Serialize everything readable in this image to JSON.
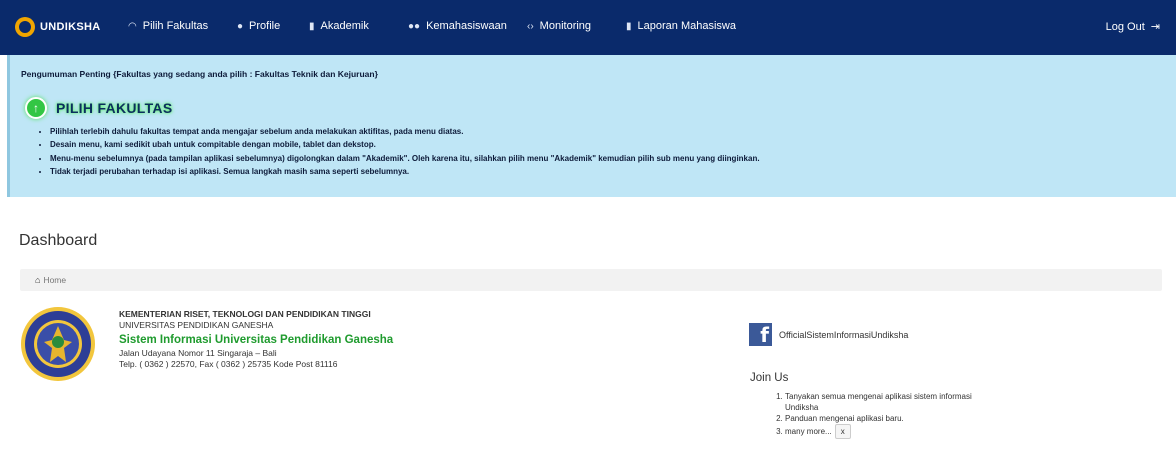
{
  "navbar": {
    "brand": "UNDIKSHA",
    "items": [
      {
        "icon": "dashboard-icon",
        "glyph": "⌒",
        "label": "Pilih Fakultas"
      },
      {
        "icon": "user-icon",
        "glyph": "▲",
        "label": "Profile"
      },
      {
        "icon": "book-icon",
        "glyph": "▮",
        "label": "Akademik"
      },
      {
        "icon": "users-icon",
        "glyph": "▲",
        "label": "Kemahasiswaan"
      },
      {
        "icon": "code-icon",
        "glyph": "‹›",
        "label": "Monitoring"
      },
      {
        "icon": "book-icon",
        "glyph": "▮",
        "label": "Laporan Mahasiswa"
      }
    ],
    "logout_label": "Log Out",
    "colors": {
      "background": "#0a2a6b",
      "brand_accent": "#f0a500"
    }
  },
  "announcement": {
    "title": "Pengumuman Penting {Fakultas yang sedang anda pilih : Fakultas Teknik dan Kejuruan}",
    "heading": "PILIH FAKULTAS",
    "items": [
      "Pilihlah terlebih dahulu fakultas tempat anda mengajar sebelum anda melakukan aktifitas, pada menu diatas.",
      "Desain menu, kami sedikit ubah untuk compitable dengan mobile, tablet dan dekstop.",
      "Menu-menu sebelumnya (pada tampilan aplikasi sebelumnya) digolongkan dalam \"Akademik\". Oleh karena itu, silahkan pilih menu \"Akademik\" kemudian pilih sub menu yang diinginkan.",
      "Tidak terjadi perubahan terhadap isi aplikasi. Semua langkah masih sama seperti sebelumnya."
    ],
    "colors": {
      "background": "#bfe6f6",
      "highlight": "#33c644"
    }
  },
  "page": {
    "title": "Dashboard",
    "breadcrumb": "Home"
  },
  "institution": {
    "ministry": "KEMENTERIAN RISET, TEKNOLOGI DAN PENDIDIKAN TINGGI",
    "university": "UNIVERSITAS PENDIDIKAN GANESHA",
    "system_name": "Sistem Informasi Universitas Pendidikan Ganesha",
    "address": "Jalan Udayana Nomor 11 Singaraja – Bali",
    "phone": "Telp. ( 0362 ) 22570, Fax ( 0362 ) 25735 Kode Post 81116"
  },
  "social": {
    "facebook_name": "OfficialSistemInformasiUndiksha"
  },
  "join_us": {
    "title": "Join Us",
    "items": [
      "Tanyakan semua mengenai aplikasi sistem informasi Undiksha",
      "Panduan mengenai aplikasi baru.",
      "many more..."
    ],
    "close_label": "x"
  }
}
